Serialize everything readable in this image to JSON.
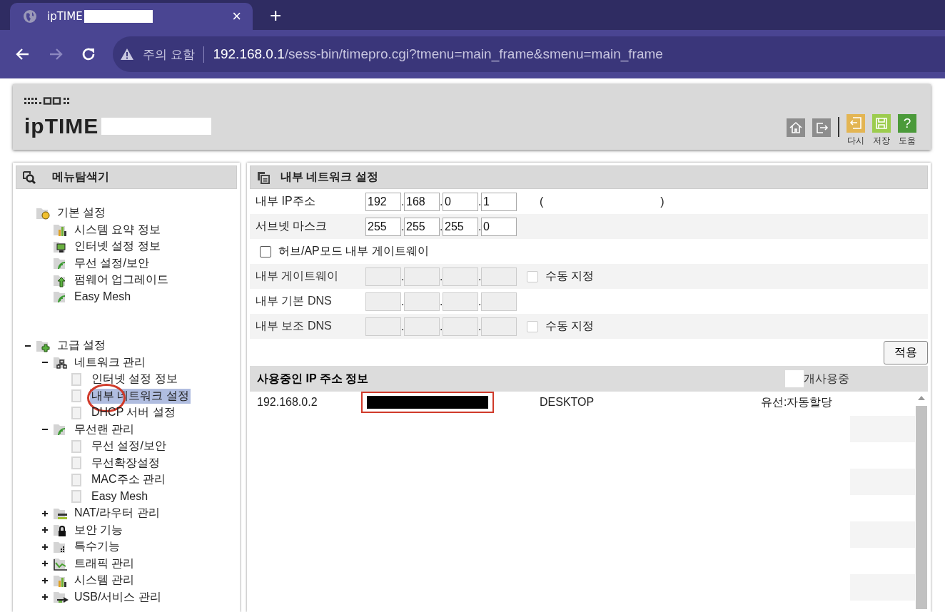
{
  "browser": {
    "tab": {
      "title": "ipTIME",
      "close": "×"
    },
    "new_tab": "+",
    "security": "주의 요함",
    "url_host": "192.168.0.1",
    "url_path": "/sess-bin/timepro.cgi?tmenu=main_frame&smenu=main_frame"
  },
  "header": {
    "logo": "ipTIME",
    "tools": [
      {
        "kind": "home"
      },
      {
        "kind": "logout"
      },
      {
        "kind": "undo",
        "label": "다시"
      },
      {
        "kind": "save",
        "label": "저장"
      },
      {
        "kind": "help",
        "label": "도움",
        "glyph": "?"
      }
    ]
  },
  "sidebar": {
    "title": "메뉴탐색기",
    "tree": [
      {
        "label": "기본 설정",
        "kind": "basic",
        "selected": false,
        "children": [
          {
            "label": "시스템 요약 정보",
            "kind": "chart",
            "selected": false
          },
          {
            "label": "인터넷 설정 정보",
            "kind": "monitor",
            "selected": false
          },
          {
            "label": "무선 설정/보안",
            "kind": "wifi",
            "selected": false
          },
          {
            "label": "펌웨어 업그레이드",
            "kind": "upgrade",
            "selected": false
          },
          {
            "label": "Easy Mesh",
            "kind": "wifi",
            "selected": false
          }
        ]
      },
      {
        "label": "고급 설정",
        "kind": "advanced",
        "selected": false,
        "expanded": true,
        "children": [
          {
            "label": "네트워크 관리",
            "kind": "network",
            "selected": false,
            "expanded": true,
            "children": [
              {
                "label": "인터넷 설정 정보",
                "kind": "page",
                "selected": false
              },
              {
                "label": "내부 네트워크 설정",
                "kind": "page",
                "selected": true
              },
              {
                "label": "DHCP 서버 설정",
                "kind": "page",
                "selected": false
              }
            ]
          },
          {
            "label": "무선랜 관리",
            "kind": "wifi",
            "selected": false,
            "expanded": true,
            "children": [
              {
                "label": "무선 설정/보안",
                "kind": "page",
                "selected": false
              },
              {
                "label": "무선확장설정",
                "kind": "page",
                "selected": false
              },
              {
                "label": "MAC주소 관리",
                "kind": "page",
                "selected": false
              },
              {
                "label": "Easy Mesh",
                "kind": "page",
                "selected": false
              }
            ]
          },
          {
            "label": "NAT/라우터 관리",
            "kind": "router",
            "selected": false,
            "expanded": false
          },
          {
            "label": "보안 기능",
            "kind": "lock",
            "selected": false,
            "expanded": false
          },
          {
            "label": "특수기능",
            "kind": "grid",
            "selected": false,
            "expanded": false
          },
          {
            "label": "트래픽 관리",
            "kind": "traffic",
            "selected": false,
            "expanded": false
          },
          {
            "label": "시스템 관리",
            "kind": "chart",
            "selected": false,
            "expanded": false
          },
          {
            "label": "USB/서비스 관리",
            "kind": "usb",
            "selected": false,
            "expanded": false
          }
        ]
      }
    ]
  },
  "main": {
    "title": "내부 네트워크 설정",
    "ip_separator": ".",
    "rows": [
      {
        "kind": "ip",
        "label": "내부 IP주소",
        "disabled": false,
        "values": [
          "192",
          "168",
          "0",
          "1"
        ],
        "note": [
          "(",
          ")"
        ]
      },
      {
        "kind": "ip",
        "label": "서브넷 마스크",
        "disabled": false,
        "values": [
          "255",
          "255",
          "255",
          "0"
        ]
      },
      {
        "kind": "checkbox",
        "label": "허브/AP모드 내부 게이트웨이",
        "checked": false
      },
      {
        "kind": "ip",
        "label": "내부 게이트웨이",
        "disabled": true,
        "manual": {
          "label": "수동 지정",
          "checked": false
        }
      },
      {
        "kind": "ip",
        "label": "내부 기본 DNS",
        "disabled": true
      },
      {
        "kind": "ip",
        "label": "내부 보조 DNS",
        "disabled": true,
        "manual": {
          "label": "수동 지정",
          "checked": false
        }
      }
    ],
    "apply": "적용",
    "table": {
      "title": "사용중인 IP 주소 정보",
      "count_label": "개사용중",
      "rows": [
        {
          "ip": "192.168.0.2",
          "name": "DESKTOP",
          "type": "유선:자동할당"
        }
      ]
    }
  }
}
